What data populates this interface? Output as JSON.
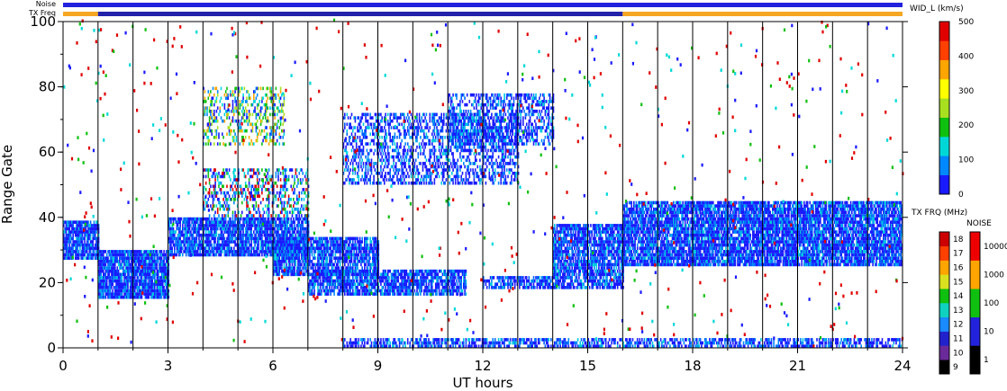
{
  "chart_data": {
    "type": "heatmap",
    "title": "",
    "xlabel": "UT hours",
    "ylabel": "Range Gate",
    "xlim": [
      0,
      24
    ],
    "ylim": [
      0,
      100
    ],
    "x_ticks": [
      "0",
      "3",
      "6",
      "9",
      "12",
      "15",
      "18",
      "21",
      "24"
    ],
    "y_ticks": [
      "0",
      "20",
      "40",
      "60",
      "80",
      "100"
    ],
    "hour_lines": [
      1,
      2,
      3,
      4,
      5,
      6,
      7,
      8,
      9,
      10,
      11,
      12,
      13,
      14,
      15,
      16,
      17,
      18,
      19,
      20,
      21,
      22,
      23
    ],
    "top_bars": [
      {
        "label": "Noise",
        "segments": [
          {
            "from": 0,
            "to": 24,
            "color": "#2222dd"
          }
        ]
      },
      {
        "label": "TX Freq",
        "segments": [
          {
            "from": 0,
            "to": 1,
            "color": "#f5a623"
          },
          {
            "from": 1,
            "to": 16,
            "color": "#2222aa"
          },
          {
            "from": 16,
            "to": 24,
            "color": "#f5a623"
          }
        ]
      }
    ],
    "echo_regions": [
      {
        "x": [
          0.0,
          1.0
        ],
        "y": [
          27,
          39
        ],
        "density": 0.85,
        "palette": "blue"
      },
      {
        "x": [
          1.0,
          3.0
        ],
        "y": [
          15,
          30
        ],
        "density": 0.9,
        "palette": "blue"
      },
      {
        "x": [
          3.0,
          7.0
        ],
        "y": [
          28,
          40
        ],
        "density": 0.85,
        "palette": "blue"
      },
      {
        "x": [
          4.0,
          7.0
        ],
        "y": [
          40,
          55
        ],
        "density": 0.35,
        "palette": "mixed"
      },
      {
        "x": [
          4.0,
          6.3
        ],
        "y": [
          62,
          80
        ],
        "density": 0.35,
        "palette": "greens"
      },
      {
        "x": [
          6.0,
          9.0
        ],
        "y": [
          22,
          34
        ],
        "density": 0.8,
        "palette": "blue"
      },
      {
        "x": [
          7.0,
          11.5
        ],
        "y": [
          16,
          24
        ],
        "density": 0.8,
        "palette": "blue"
      },
      {
        "x": [
          8.0,
          13.0
        ],
        "y": [
          50,
          72
        ],
        "density": 0.45,
        "palette": "blue"
      },
      {
        "x": [
          11.0,
          14.0
        ],
        "y": [
          62,
          78
        ],
        "density": 0.5,
        "palette": "blue"
      },
      {
        "x": [
          12.0,
          14.0
        ],
        "y": [
          18,
          22
        ],
        "density": 0.7,
        "palette": "blue"
      },
      {
        "x": [
          14.0,
          16.0
        ],
        "y": [
          18,
          38
        ],
        "density": 0.8,
        "palette": "blue"
      },
      {
        "x": [
          16.0,
          24.0
        ],
        "y": [
          25,
          45
        ],
        "density": 0.85,
        "palette": "blue"
      },
      {
        "x": [
          8.0,
          24.0
        ],
        "y": [
          0,
          3
        ],
        "density": 0.6,
        "palette": "blue"
      }
    ],
    "velocity_width_scale": {
      "title": "WID_L (km/s)",
      "ticks": [
        "0",
        "100",
        "200",
        "300",
        "400",
        "500"
      ],
      "colors": [
        "#1a1aff",
        "#0088ff",
        "#00d8d8",
        "#10c010",
        "#a8e020",
        "#ffff00",
        "#ffa500",
        "#ff4000",
        "#e00000"
      ]
    },
    "tx_freq_scale": {
      "title": "TX FRQ (MHz)",
      "ticks": [
        "9",
        "10",
        "11",
        "12",
        "13",
        "14",
        "15",
        "16",
        "17",
        "18"
      ],
      "colors": [
        "#000000",
        "#6a2a9a",
        "#2222cc",
        "#1a8aff",
        "#10d0c0",
        "#10c010",
        "#d8e020",
        "#ffa500",
        "#ff4000",
        "#cc0000"
      ]
    },
    "noise_scale": {
      "title": "NOISE",
      "ticks": [
        "1",
        "10",
        "100",
        "1000",
        "10000"
      ],
      "colors": [
        "#000000",
        "#2222dd",
        "#10c010",
        "#ffa500",
        "#ee0000"
      ]
    }
  }
}
